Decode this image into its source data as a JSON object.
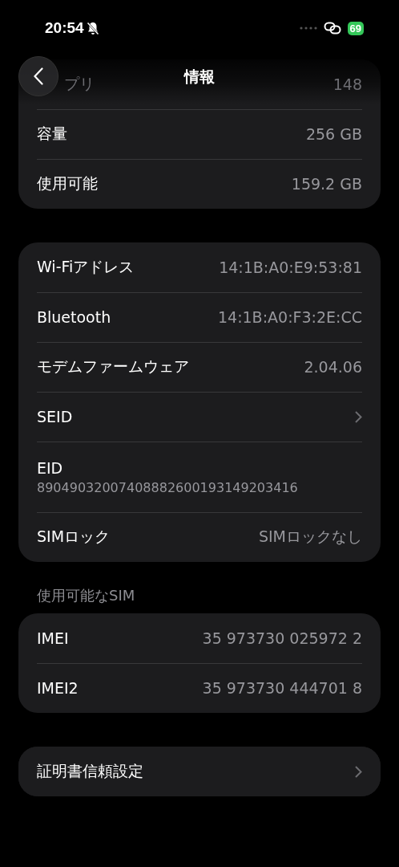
{
  "status_bar": {
    "time": "20:54",
    "battery": "69"
  },
  "header": {
    "title": "情報"
  },
  "groups": [
    {
      "rows": [
        {
          "kind": "faded",
          "label": "プリ",
          "value": "148"
        },
        {
          "kind": "value",
          "label": "容量",
          "value": "256 GB"
        },
        {
          "kind": "value",
          "label": "使用可能",
          "value": "159.2 GB"
        }
      ]
    },
    {
      "rows": [
        {
          "kind": "value",
          "label": "Wi-Fiアドレス",
          "value": "14:1B:A0:E9:53:81"
        },
        {
          "kind": "value",
          "label": "Bluetooth",
          "value": "14:1B:A0:F3:2E:CC"
        },
        {
          "kind": "value",
          "label": "モデムファームウェア",
          "value": "2.04.06"
        },
        {
          "kind": "link",
          "label": "SEID"
        },
        {
          "kind": "stacked",
          "label": "EID",
          "value": "89049032007408882600193149203416"
        },
        {
          "kind": "value",
          "label": "SIMロック",
          "value": "SIMロックなし"
        }
      ]
    },
    {
      "heading": "使用可能なSIM",
      "rows": [
        {
          "kind": "value",
          "label": "IMEI",
          "value": "35 973730 025972 2"
        },
        {
          "kind": "value",
          "label": "IMEI2",
          "value": "35 973730 444701 8"
        }
      ]
    },
    {
      "rows": [
        {
          "kind": "link",
          "label": "証明書信頼設定"
        }
      ]
    }
  ]
}
